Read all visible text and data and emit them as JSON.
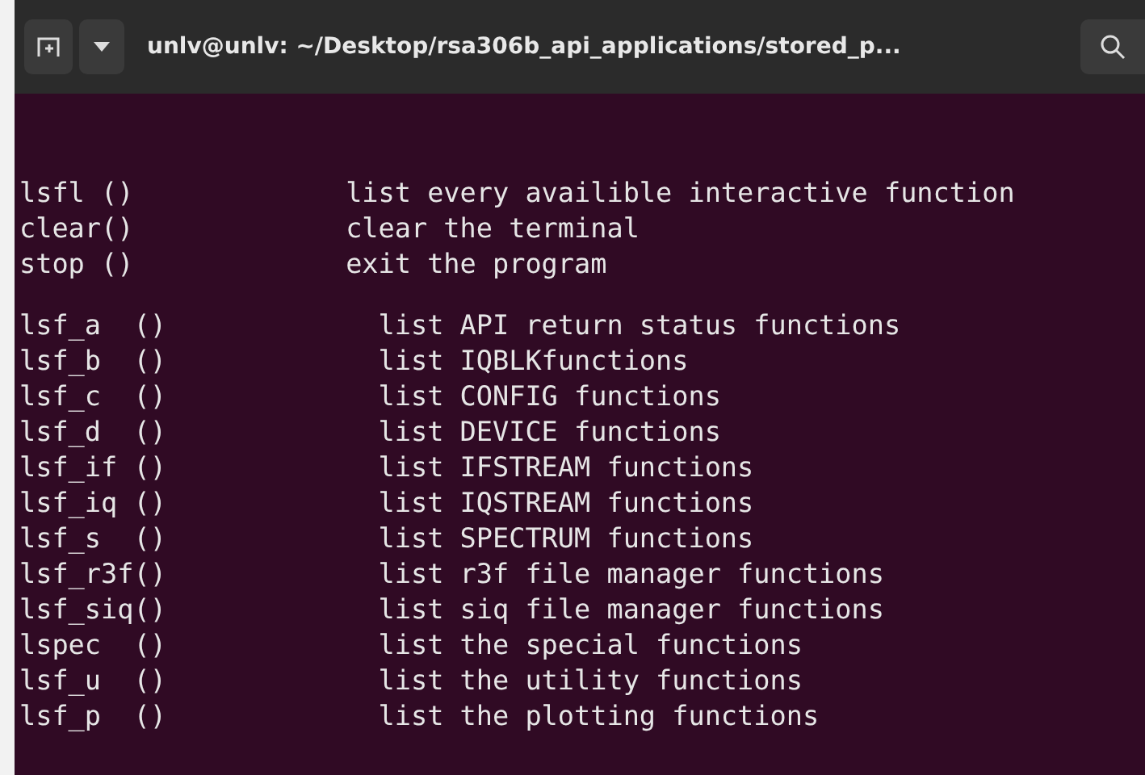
{
  "window": {
    "title": "unlv@unlv: ~/Desktop/rsa306b_api_applications/stored_p..."
  },
  "groups": [
    {
      "lines": [
        {
          "command": "lsfl ()",
          "description": "list every availible interactive function"
        },
        {
          "command": "clear()",
          "description": "clear the terminal"
        },
        {
          "command": "stop ()",
          "description": "exit the program"
        }
      ]
    },
    {
      "lines": [
        {
          "command": "lsf_a  ()",
          "description": "list API return status functions"
        },
        {
          "command": "lsf_b  ()",
          "description": "list IQBLKfunctions"
        },
        {
          "command": "lsf_c  ()",
          "description": "list CONFIG functions"
        },
        {
          "command": "lsf_d  ()",
          "description": "list DEVICE functions"
        },
        {
          "command": "lsf_if ()",
          "description": "list IFSTREAM functions"
        },
        {
          "command": "lsf_iq ()",
          "description": "list IQSTREAM functions"
        },
        {
          "command": "lsf_s  ()",
          "description": "list SPECTRUM functions"
        },
        {
          "command": "lsf_r3f()",
          "description": "list r3f file manager functions"
        },
        {
          "command": "lsf_siq()",
          "description": "list siq file manager functions"
        },
        {
          "command": "lspec  ()",
          "description": "list the special functions"
        },
        {
          "command": "lsf_u  ()",
          "description": "list the utility functions"
        },
        {
          "command": "lsf_p  ()",
          "description": "list the plotting functions"
        }
      ]
    }
  ]
}
